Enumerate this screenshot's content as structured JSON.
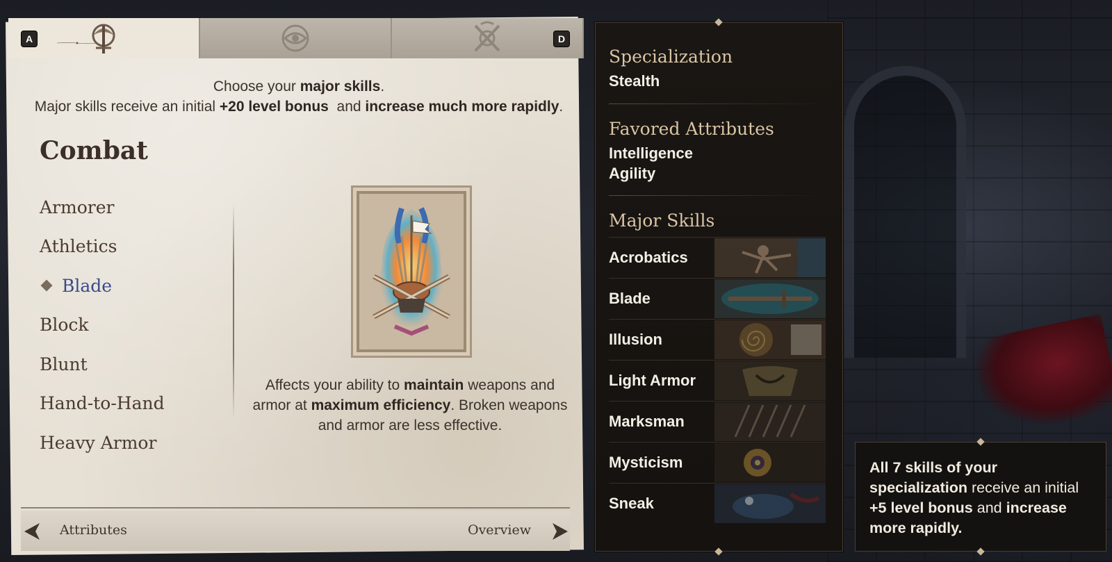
{
  "tabs": {
    "prev_key": "A",
    "next_key": "D",
    "items": [
      {
        "icon": "crossed-axe-icon",
        "active": true
      },
      {
        "icon": "eye-icon",
        "active": false
      },
      {
        "icon": "shield-crest-icon",
        "active": false
      }
    ]
  },
  "intro": {
    "line1_pre": "Choose your ",
    "line1_bold": "major skills",
    "line1_post": ".",
    "line2_pre": "Major skills receive an initial ",
    "line2_bold1": "+20 level bonus",
    "line2_mid": "  and ",
    "line2_bold2": "increase much more rapidly",
    "line2_post": "."
  },
  "category": {
    "title": "Combat",
    "skills": [
      {
        "label": "Armorer",
        "selected": false
      },
      {
        "label": "Athletics",
        "selected": false
      },
      {
        "label": "Blade",
        "selected": true
      },
      {
        "label": "Block",
        "selected": false
      },
      {
        "label": "Blunt",
        "selected": false
      },
      {
        "label": "Hand-to-Hand",
        "selected": false
      },
      {
        "label": "Heavy Armor",
        "selected": false
      }
    ]
  },
  "detail": {
    "card_icon": "armorer-card-icon",
    "d1": "Affects your ability to ",
    "d1b": "maintain",
    "d2": " weapons and armor at ",
    "d2b": "maximum efficiency",
    "d3": ". Broken weapons and armor are less effective."
  },
  "footer": {
    "prev_label": "Attributes",
    "next_label": "Overview"
  },
  "summary": {
    "specialization_title": "Specialization",
    "specialization_value": "Stealth",
    "favored_title": "Favored Attributes",
    "favored": [
      "Intelligence",
      "Agility"
    ],
    "major_title": "Major Skills",
    "major": [
      {
        "label": "Acrobatics",
        "icon": "acrobat-art"
      },
      {
        "label": "Blade",
        "icon": "sword-art"
      },
      {
        "label": "Illusion",
        "icon": "spiral-art"
      },
      {
        "label": "Light Armor",
        "icon": "armor-art"
      },
      {
        "label": "Marksman",
        "icon": "arrow-art"
      },
      {
        "label": "Mysticism",
        "icon": "sun-art"
      },
      {
        "label": "Sneak",
        "icon": "frog-art"
      }
    ]
  },
  "tooltip": {
    "t1": "All 7 skills of your specialization",
    "t2": " receive an initial ",
    "t3": "+5 level bonus",
    "t4": " and ",
    "t5": "increase more rapidly."
  },
  "colors": {
    "parchment": "#e6e0d5",
    "ink": "#3b332b",
    "selected_skill": "#3a4a8a",
    "panel_bg": "#15120f",
    "panel_title": "#d9c5a4"
  }
}
